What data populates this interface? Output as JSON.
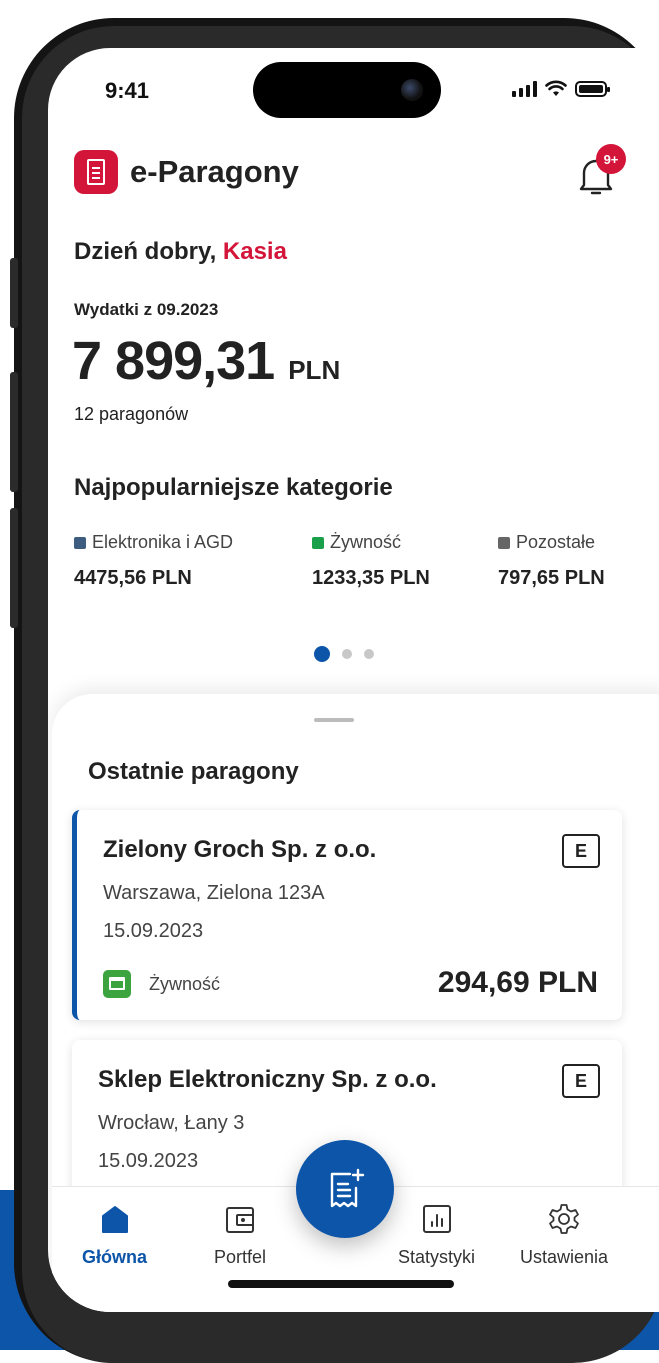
{
  "status_bar": {
    "time": "9:41"
  },
  "header": {
    "brand": "e-Paragony",
    "notifications_badge": "9+"
  },
  "greeting": {
    "prefix": "Dzień dobry, ",
    "name": "Kasia"
  },
  "summary": {
    "label": "Wydatki z 09.2023",
    "amount": "7 899,31",
    "currency": "PLN",
    "receipts_count": "12 paragonów"
  },
  "categories": {
    "title": "Najpopularniejsze kategorie",
    "items": [
      {
        "label": "Elektronika i AGD",
        "value": "4475,56 PLN",
        "color": "#3e5c80"
      },
      {
        "label": "Żywność",
        "value": "1233,35 PLN",
        "color": "#1aa04a"
      },
      {
        "label": "Pozostałe",
        "value": "797,65 PLN",
        "color": "#666666"
      }
    ],
    "pager": {
      "pages": 3,
      "active": 1
    }
  },
  "recent": {
    "title": "Ostatnie paragony",
    "receipts": [
      {
        "merchant": "Zielony Groch Sp. z o.o.",
        "address": "Warszawa, Zielona 123A",
        "date": "15.09.2023",
        "badge": "E",
        "category": "Żywność",
        "amount": "294,69 PLN"
      },
      {
        "merchant": "Sklep Elektroniczny Sp. z o.o.",
        "address": "Wrocław, Łany 3",
        "date": "15.09.2023",
        "badge": "E"
      }
    ]
  },
  "tabbar": {
    "items": [
      {
        "label": "Główna",
        "icon": "home-icon",
        "active": true
      },
      {
        "label": "Portfel",
        "icon": "wallet-icon"
      },
      {
        "label": "Statystyki",
        "icon": "stats-icon"
      },
      {
        "label": "Ustawienia",
        "icon": "gear-icon"
      }
    ],
    "fab_icon": "add-receipt-icon",
    "colors": {
      "active": "#0d55a8",
      "brand": "#d4153a"
    }
  }
}
